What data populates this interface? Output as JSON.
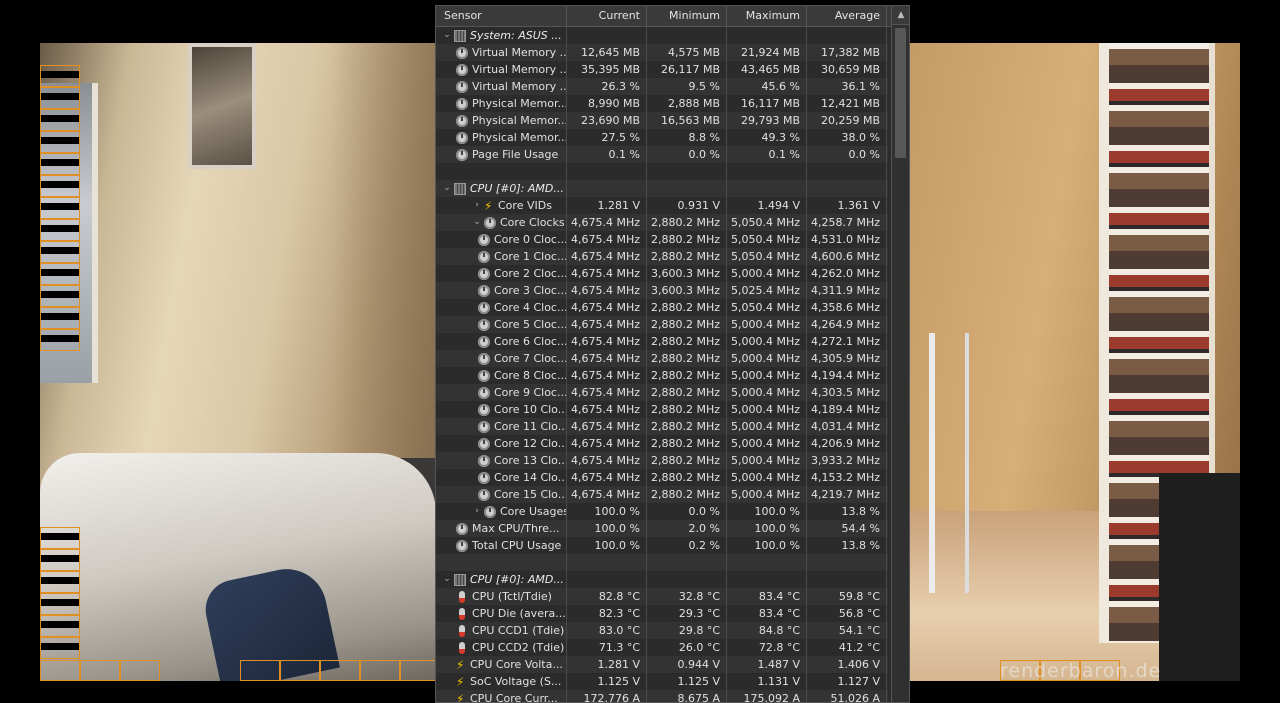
{
  "watermark": "renderbaron.de",
  "panel": {
    "columns": [
      "Sensor",
      "Current",
      "Minimum",
      "Maximum",
      "Average"
    ],
    "rows": [
      {
        "kind": "group",
        "indent": 0,
        "label": "System: ASUS ...",
        "current": "",
        "minimum": "",
        "maximum": "",
        "average": ""
      },
      {
        "kind": "sensor",
        "icon": "clock-icon",
        "indent": 1,
        "label": "Virtual Memory ...",
        "current": "12,645 MB",
        "minimum": "4,575 MB",
        "maximum": "21,924 MB",
        "average": "17,382 MB"
      },
      {
        "kind": "sensor",
        "icon": "clock-icon",
        "indent": 1,
        "label": "Virtual Memory ...",
        "current": "35,395 MB",
        "minimum": "26,117 MB",
        "maximum": "43,465 MB",
        "average": "30,659 MB"
      },
      {
        "kind": "sensor",
        "icon": "clock-icon",
        "indent": 1,
        "label": "Virtual Memory ...",
        "current": "26.3 %",
        "minimum": "9.5 %",
        "maximum": "45.6 %",
        "average": "36.1 %"
      },
      {
        "kind": "sensor",
        "icon": "clock-icon",
        "indent": 1,
        "label": "Physical Memor...",
        "current": "8,990 MB",
        "minimum": "2,888 MB",
        "maximum": "16,117 MB",
        "average": "12,421 MB"
      },
      {
        "kind": "sensor",
        "icon": "clock-icon",
        "indent": 1,
        "label": "Physical Memor...",
        "current": "23,690 MB",
        "minimum": "16,563 MB",
        "maximum": "29,793 MB",
        "average": "20,259 MB"
      },
      {
        "kind": "sensor",
        "icon": "clock-icon",
        "indent": 1,
        "label": "Physical Memor...",
        "current": "27.5 %",
        "minimum": "8.8 %",
        "maximum": "49.3 %",
        "average": "38.0 %"
      },
      {
        "kind": "sensor",
        "icon": "clock-icon",
        "indent": 1,
        "label": "Page File Usage",
        "current": "0.1 %",
        "minimum": "0.0 %",
        "maximum": "0.1 %",
        "average": "0.0 %"
      },
      {
        "kind": "blank",
        "indent": 0,
        "label": "",
        "current": "",
        "minimum": "",
        "maximum": "",
        "average": ""
      },
      {
        "kind": "group",
        "indent": 0,
        "label": "CPU [#0]: AMD...",
        "current": "",
        "minimum": "",
        "maximum": "",
        "average": ""
      },
      {
        "kind": "sensor",
        "icon": "bolt-icon",
        "indent": 2,
        "twisty": "›",
        "label": "Core VIDs",
        "current": "1.281 V",
        "minimum": "0.931 V",
        "maximum": "1.494 V",
        "average": "1.361 V"
      },
      {
        "kind": "sensor",
        "icon": "clock-icon",
        "indent": 2,
        "twisty": "⌄",
        "label": "Core Clocks",
        "current": "4,675.4 MHz",
        "minimum": "2,880.2 MHz",
        "maximum": "5,050.4 MHz",
        "average": "4,258.7 MHz"
      },
      {
        "kind": "sensor",
        "icon": "clock-icon",
        "indent": 3,
        "label": "Core 0 Cloc...",
        "current": "4,675.4 MHz",
        "minimum": "2,880.2 MHz",
        "maximum": "5,050.4 MHz",
        "average": "4,531.0 MHz"
      },
      {
        "kind": "sensor",
        "icon": "clock-icon",
        "indent": 3,
        "label": "Core 1 Cloc...",
        "current": "4,675.4 MHz",
        "minimum": "2,880.2 MHz",
        "maximum": "5,050.4 MHz",
        "average": "4,600.6 MHz"
      },
      {
        "kind": "sensor",
        "icon": "clock-icon",
        "indent": 3,
        "label": "Core 2 Cloc...",
        "current": "4,675.4 MHz",
        "minimum": "3,600.3 MHz",
        "maximum": "5,000.4 MHz",
        "average": "4,262.0 MHz"
      },
      {
        "kind": "sensor",
        "icon": "clock-icon",
        "indent": 3,
        "label": "Core 3 Cloc...",
        "current": "4,675.4 MHz",
        "minimum": "3,600.3 MHz",
        "maximum": "5,025.4 MHz",
        "average": "4,311.9 MHz"
      },
      {
        "kind": "sensor",
        "icon": "clock-icon",
        "indent": 3,
        "label": "Core 4 Cloc...",
        "current": "4,675.4 MHz",
        "minimum": "2,880.2 MHz",
        "maximum": "5,050.4 MHz",
        "average": "4,358.6 MHz"
      },
      {
        "kind": "sensor",
        "icon": "clock-icon",
        "indent": 3,
        "label": "Core 5 Cloc...",
        "current": "4,675.4 MHz",
        "minimum": "2,880.2 MHz",
        "maximum": "5,000.4 MHz",
        "average": "4,264.9 MHz"
      },
      {
        "kind": "sensor",
        "icon": "clock-icon",
        "indent": 3,
        "label": "Core 6 Cloc...",
        "current": "4,675.4 MHz",
        "minimum": "2,880.2 MHz",
        "maximum": "5,000.4 MHz",
        "average": "4,272.1 MHz"
      },
      {
        "kind": "sensor",
        "icon": "clock-icon",
        "indent": 3,
        "label": "Core 7 Cloc...",
        "current": "4,675.4 MHz",
        "minimum": "2,880.2 MHz",
        "maximum": "5,000.4 MHz",
        "average": "4,305.9 MHz"
      },
      {
        "kind": "sensor",
        "icon": "clock-icon",
        "indent": 3,
        "label": "Core 8 Cloc...",
        "current": "4,675.4 MHz",
        "minimum": "2,880.2 MHz",
        "maximum": "5,000.4 MHz",
        "average": "4,194.4 MHz"
      },
      {
        "kind": "sensor",
        "icon": "clock-icon",
        "indent": 3,
        "label": "Core 9 Cloc...",
        "current": "4,675.4 MHz",
        "minimum": "2,880.2 MHz",
        "maximum": "5,000.4 MHz",
        "average": "4,303.5 MHz"
      },
      {
        "kind": "sensor",
        "icon": "clock-icon",
        "indent": 3,
        "label": "Core 10 Clo...",
        "current": "4,675.4 MHz",
        "minimum": "2,880.2 MHz",
        "maximum": "5,000.4 MHz",
        "average": "4,189.4 MHz"
      },
      {
        "kind": "sensor",
        "icon": "clock-icon",
        "indent": 3,
        "label": "Core 11 Clo...",
        "current": "4,675.4 MHz",
        "minimum": "2,880.2 MHz",
        "maximum": "5,000.4 MHz",
        "average": "4,031.4 MHz"
      },
      {
        "kind": "sensor",
        "icon": "clock-icon",
        "indent": 3,
        "label": "Core 12 Clo...",
        "current": "4,675.4 MHz",
        "minimum": "2,880.2 MHz",
        "maximum": "5,000.4 MHz",
        "average": "4,206.9 MHz"
      },
      {
        "kind": "sensor",
        "icon": "clock-icon",
        "indent": 3,
        "label": "Core 13 Clo...",
        "current": "4,675.4 MHz",
        "minimum": "2,880.2 MHz",
        "maximum": "5,000.4 MHz",
        "average": "3,933.2 MHz"
      },
      {
        "kind": "sensor",
        "icon": "clock-icon",
        "indent": 3,
        "label": "Core 14 Clo...",
        "current": "4,675.4 MHz",
        "minimum": "2,880.2 MHz",
        "maximum": "5,000.4 MHz",
        "average": "4,153.2 MHz"
      },
      {
        "kind": "sensor",
        "icon": "clock-icon",
        "indent": 3,
        "label": "Core 15 Clo...",
        "current": "4,675.4 MHz",
        "minimum": "2,880.2 MHz",
        "maximum": "5,000.4 MHz",
        "average": "4,219.7 MHz"
      },
      {
        "kind": "sensor",
        "icon": "clock-icon",
        "indent": 2,
        "twisty": "›",
        "label": "Core Usages",
        "current": "100.0 %",
        "minimum": "0.0 %",
        "maximum": "100.0 %",
        "average": "13.8 %"
      },
      {
        "kind": "sensor",
        "icon": "clock-icon",
        "indent": 1,
        "label": "Max CPU/Thre...",
        "current": "100.0 %",
        "minimum": "2.0 %",
        "maximum": "100.0 %",
        "average": "54.4 %"
      },
      {
        "kind": "sensor",
        "icon": "clock-icon",
        "indent": 1,
        "label": "Total CPU Usage",
        "current": "100.0 %",
        "minimum": "0.2 %",
        "maximum": "100.0 %",
        "average": "13.8 %"
      },
      {
        "kind": "blank",
        "indent": 0,
        "label": "",
        "current": "",
        "minimum": "",
        "maximum": "",
        "average": ""
      },
      {
        "kind": "group",
        "indent": 0,
        "label": "CPU [#0]: AMD...",
        "current": "",
        "minimum": "",
        "maximum": "",
        "average": ""
      },
      {
        "kind": "sensor",
        "icon": "thermometer-icon",
        "indent": 1,
        "label": "CPU (Tctl/Tdie)",
        "current": "82.8 °C",
        "minimum": "32.8 °C",
        "maximum": "83.4 °C",
        "average": "59.8 °C"
      },
      {
        "kind": "sensor",
        "icon": "thermometer-icon",
        "indent": 1,
        "label": "CPU Die (avera...",
        "current": "82.3 °C",
        "minimum": "29.3 °C",
        "maximum": "83.4 °C",
        "average": "56.8 °C"
      },
      {
        "kind": "sensor",
        "icon": "thermometer-icon",
        "indent": 1,
        "label": "CPU CCD1 (Tdie)",
        "current": "83.0 °C",
        "minimum": "29.8 °C",
        "maximum": "84.8 °C",
        "average": "54.1 °C"
      },
      {
        "kind": "sensor",
        "icon": "thermometer-icon",
        "indent": 1,
        "label": "CPU CCD2 (Tdie)",
        "current": "71.3 °C",
        "minimum": "26.0 °C",
        "maximum": "72.8 °C",
        "average": "41.2 °C"
      },
      {
        "kind": "sensor",
        "icon": "bolt-icon",
        "indent": 1,
        "label": "CPU Core Volta...",
        "current": "1.281 V",
        "minimum": "0.944 V",
        "maximum": "1.487 V",
        "average": "1.406 V"
      },
      {
        "kind": "sensor",
        "icon": "bolt-icon",
        "indent": 1,
        "label": "SoC Voltage (S...",
        "current": "1.125 V",
        "minimum": "1.125 V",
        "maximum": "1.131 V",
        "average": "1.127 V"
      },
      {
        "kind": "sensor",
        "icon": "bolt-icon",
        "indent": 1,
        "label": "CPU Core Curr...",
        "current": "172.776 A",
        "minimum": "8.675 A",
        "maximum": "175.092 A",
        "average": "51.026 A"
      }
    ]
  }
}
